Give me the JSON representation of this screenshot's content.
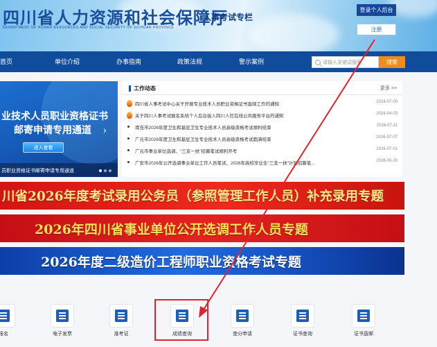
{
  "header": {
    "title": "四川省人力资源和社会保障厅",
    "subtitle": "DEPARTMENT OF HUMAN RESOURCES AND SOCIAL SECURITY OF SICHUAN PROVINCE",
    "column_name": "人事考试专栏",
    "login_label": "登录个人后台",
    "register_label": "注册"
  },
  "nav": {
    "items": [
      "首页",
      "单位介绍",
      "办事指南",
      "政策法规",
      "警示案例"
    ],
    "search_placeholder": "请输入关键词搜索",
    "search_button": "搜索"
  },
  "banner": {
    "line1": "业技术人员职业资格证书",
    "line2": "邮寄申请专用通道",
    "enter_label": "进入查看",
    "caption": "员职业资格证书邮寄申请专用通道",
    "next_icon": "chevron-right-icon"
  },
  "news": {
    "title": "工作动态",
    "more_label": "更多 >>",
    "items": [
      {
        "text": "四川省人事考试中心关于开展专业技术人员职业资格证书直邮工作的通知",
        "date": "2024-07-09",
        "hot": true
      },
      {
        "text": "关于四川人事考试报名系统个人后台接入四川人社在线公共服务平台的通知",
        "date": "2024-04-03",
        "hot": true
      },
      {
        "text": "南充市2026年度卫生和基层卫生专业技术人员高级资格考试顺利结束",
        "date": "2026-07-11",
        "hot": false
      },
      {
        "text": "广元市2026年度卫生和基层卫生专业技术人员高级资格考试圆满结束",
        "date": "2026-07-07",
        "hot": false
      },
      {
        "text": "广元市事业单位选调、“三支一扶”招募笔试顺利开考",
        "date": "2026-07-01",
        "hot": false
      },
      {
        "text": "广安市2026年公开选调事业单位工作人员笔试、2026年高校毕业生“三支一扶”计划招募笔...",
        "date": "2026-06-29",
        "hot": false
      }
    ]
  },
  "specials": [
    "川省2026年度考试录用公务员（参照管理工作人员）补充录用专题",
    "2026年四川省事业单位公开选调工作人员专题",
    "2026年度二级造价工程师职业资格考试专题"
  ],
  "services": [
    {
      "label": "报名",
      "icon": "signup-icon"
    },
    {
      "label": "电子发票",
      "icon": "invoice-icon"
    },
    {
      "label": "准考证",
      "icon": "admission-ticket-icon"
    },
    {
      "label": "成绩查询",
      "icon": "score-query-icon"
    },
    {
      "label": "查分申请",
      "icon": "score-review-icon"
    },
    {
      "label": "证书查询",
      "icon": "certificate-query-icon"
    },
    {
      "label": "证书直邮",
      "icon": "certificate-mail-icon"
    }
  ],
  "colors": {
    "primary": "#0f4c9c",
    "accent": "#f08b1c",
    "annotation": "#e0242b"
  }
}
